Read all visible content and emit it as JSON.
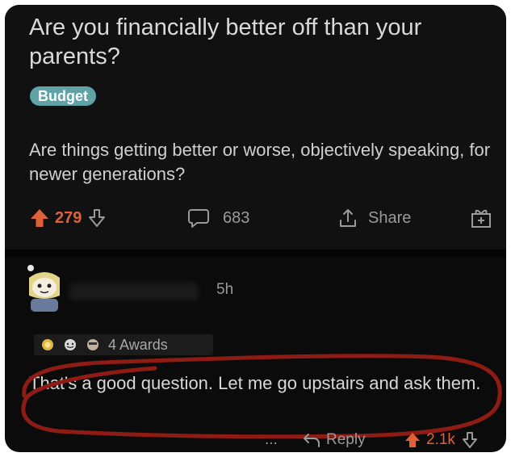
{
  "post": {
    "title": "Are you financially better off than your parents?",
    "flair": "Budget",
    "body": "Are things getting better or worse, objectively speaking, for newer generations?",
    "upvotes": "279",
    "comments": "683",
    "share_label": "Share"
  },
  "comment": {
    "time": "5h",
    "awards_label": "4 Awards",
    "text": "That's a good question. Let me go upstairs and ask them.",
    "more": "...",
    "reply_label": "Reply",
    "score": "2.1k"
  },
  "colors": {
    "background": "#0b0b0c",
    "upvote": "#e0603a",
    "flair": "#5fa3a7",
    "annotation": "#8e1b14"
  }
}
